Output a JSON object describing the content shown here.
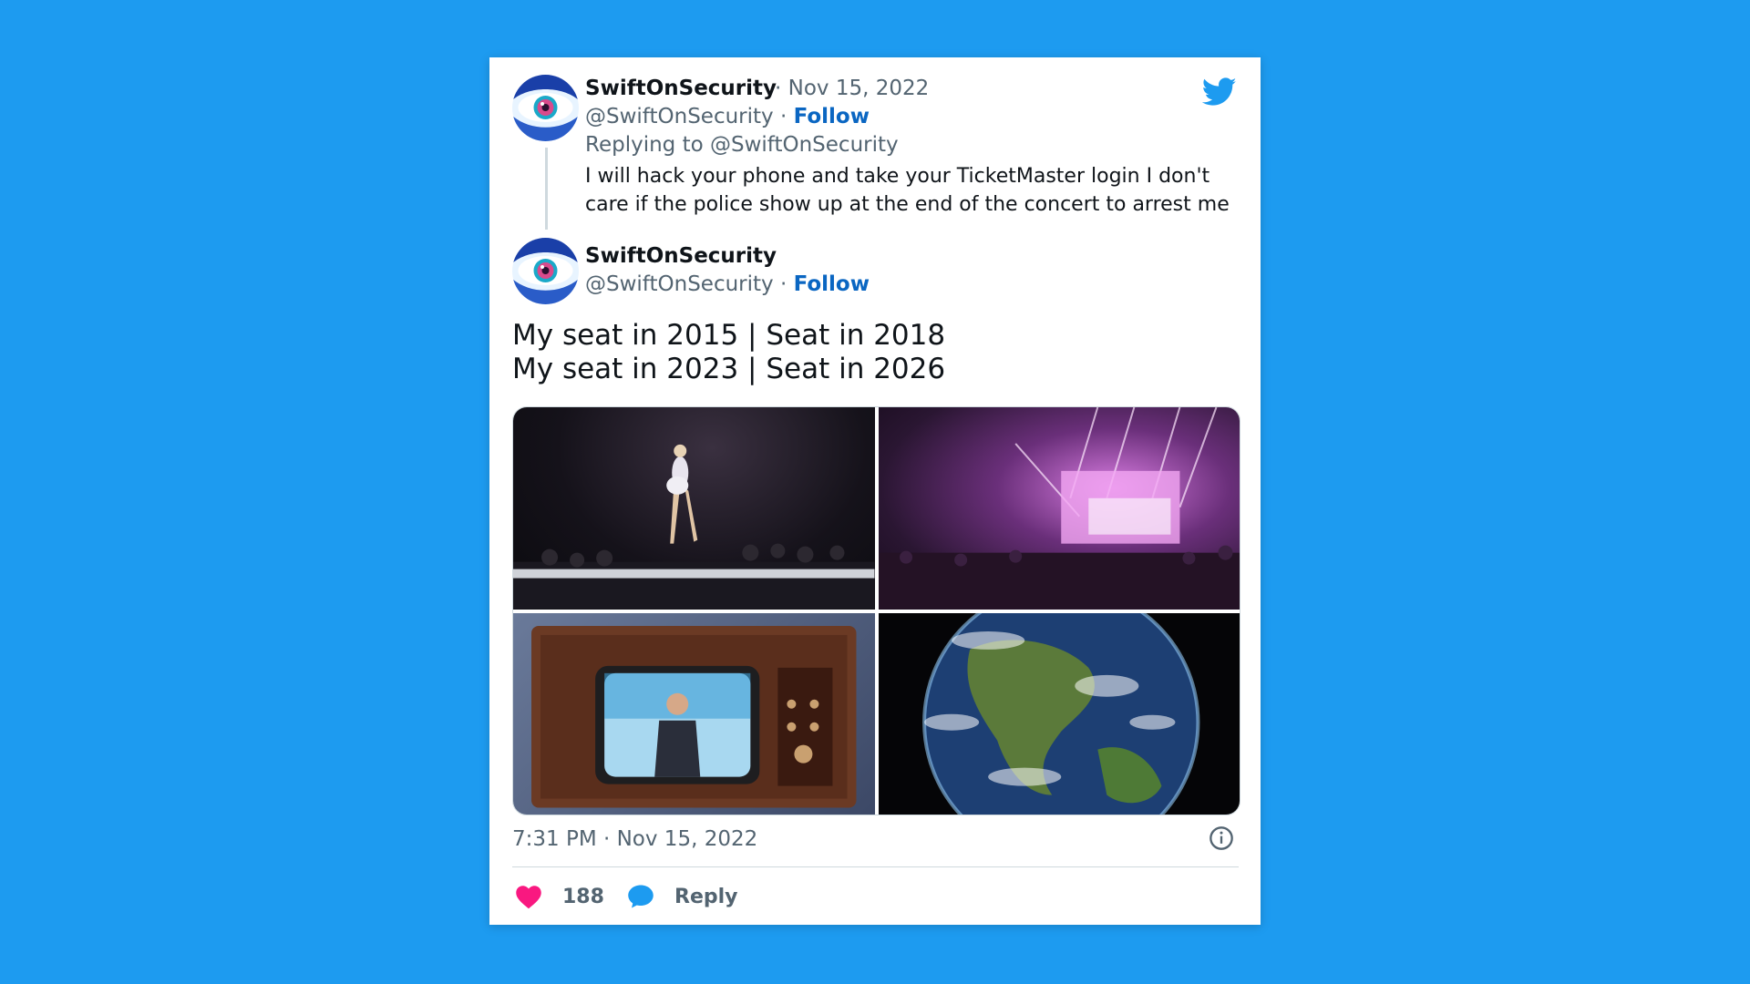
{
  "reply_tweet": {
    "display_name": "SwiftOnSecurity",
    "date": "· Nov 15, 2022",
    "handle": "@SwiftOnSecurity",
    "sep": "·",
    "follow": "Follow",
    "replying_to": "Replying to @SwiftOnSecurity",
    "text": "I will hack your phone and take your TicketMaster login I don't care if the police show up at the end of the concert to arrest me"
  },
  "main_tweet": {
    "display_name": "SwiftOnSecurity",
    "handle": "@SwiftOnSecurity",
    "sep": "·",
    "follow": "Follow",
    "line1": "My seat in 2015 | Seat in 2018",
    "line2": "My seat in 2023 | Seat in 2026",
    "timestamp": "7:31 PM · Nov 15, 2022",
    "likes": "188",
    "reply": "Reply"
  },
  "icons": {
    "logo": "twitter-bird-icon",
    "info": "info-icon",
    "like": "heart-icon",
    "reply": "speech-bubble-icon"
  },
  "colors": {
    "background": "#1d9bf0",
    "follow": "#0a66c2",
    "heart": "#f91880",
    "reply": "#1d9bf0"
  }
}
